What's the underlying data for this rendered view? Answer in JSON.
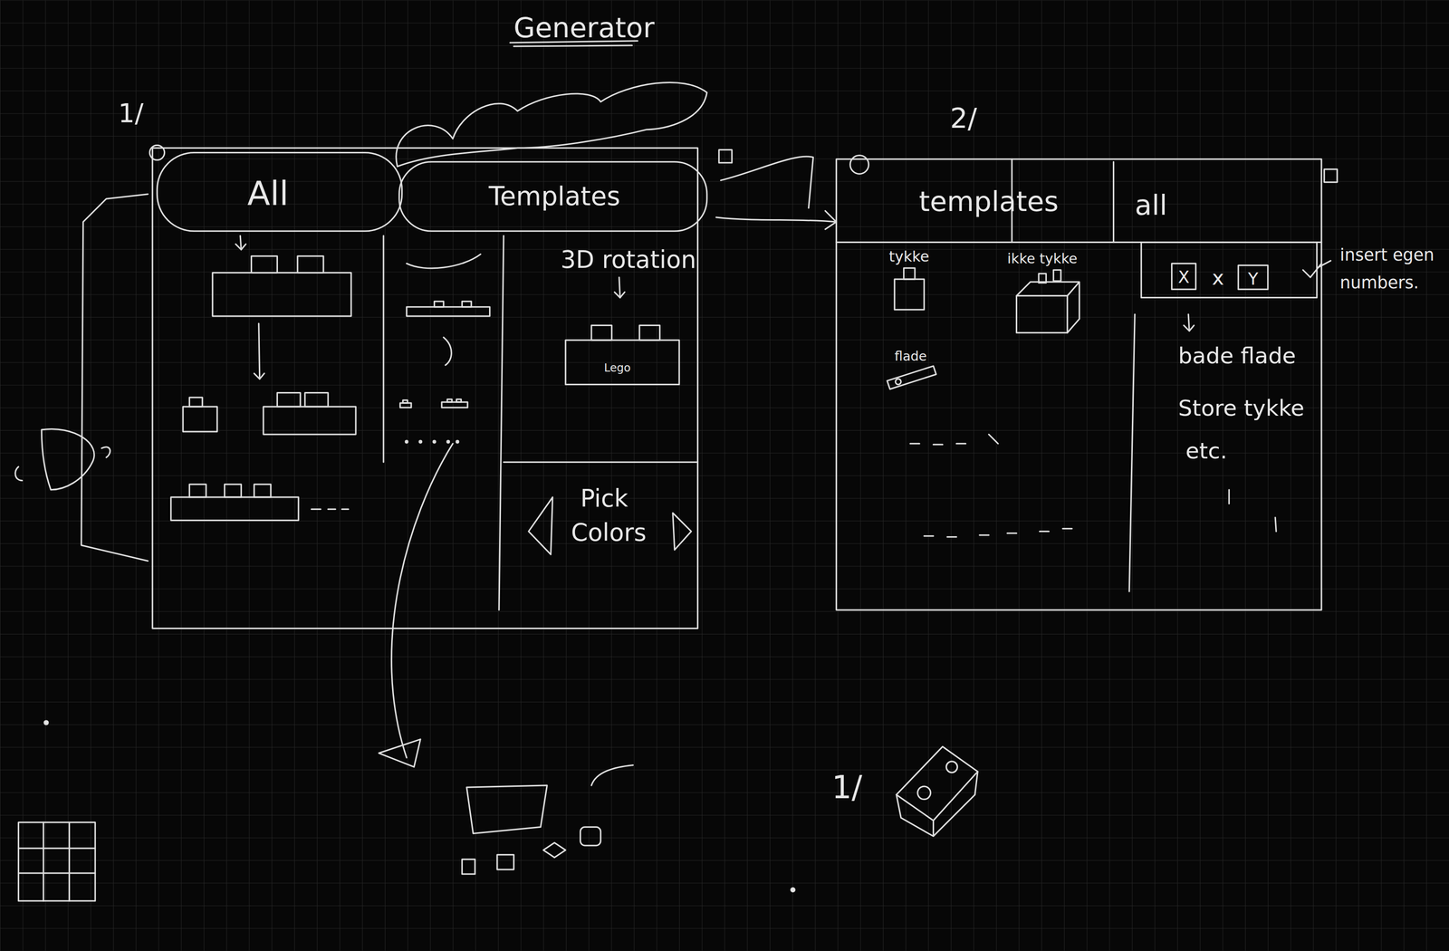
{
  "title": "Generator",
  "sketch_1": {
    "number": "1/",
    "tabs": [
      {
        "label": "All"
      },
      {
        "label": "Templates"
      }
    ],
    "preview": {
      "heading": "3D rotation",
      "brick_label": "Lego"
    },
    "color_picker": {
      "label_lines": [
        "Pick",
        "Colors"
      ]
    }
  },
  "sketch_2": {
    "number": "2/",
    "tabs": [
      {
        "label": "templates"
      },
      {
        "label": "all"
      }
    ],
    "templates": [
      {
        "label": "tykke"
      },
      {
        "label": "ikke tykke"
      },
      {
        "label": "flade"
      }
    ],
    "size_input": {
      "fields": [
        "X",
        "x",
        "Y"
      ],
      "note_lines": [
        "insert egen",
        "numbers."
      ]
    },
    "presets": [
      "bade flade",
      "Store tykke",
      "etc."
    ]
  },
  "detail": {
    "number": "1/"
  }
}
